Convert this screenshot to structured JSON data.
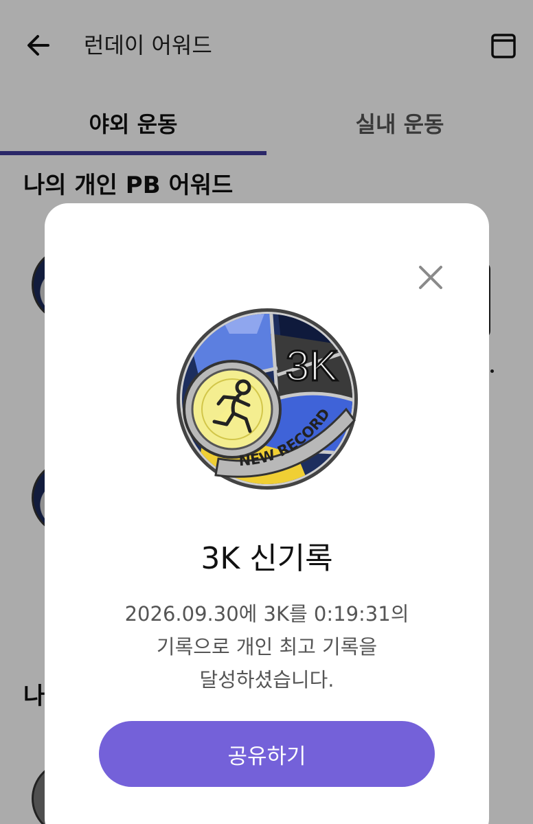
{
  "app_bar": {
    "title": "런데이 어워드",
    "back_icon": "back-arrow-icon",
    "archive_icon": "box-icon"
  },
  "tabs": [
    {
      "label": "야외 운동",
      "selected": true
    },
    {
      "label": "실내 운동",
      "selected": false
    }
  ],
  "colors": {
    "accent": "#7461d9",
    "tab_indicator": "#3f3b9c",
    "scrim": "rgba(0,0,0,0.33)"
  },
  "sections": {
    "pb_title": "나의 개인 PB 어워드",
    "second_title_fragment": "나"
  },
  "dialog": {
    "badge": {
      "icon": "new-record-3k-medal-icon",
      "distance_text": "3K",
      "banner_text": "NEW RECORD"
    },
    "title": "3K 신기록",
    "description": {
      "line1": "2026.09.30에 3K를 0:19:31의",
      "line2": "기록으로 개인 최고 기록을",
      "line3": "달성하셨습니다."
    },
    "share_label": "공유하기",
    "close_icon": "close-icon"
  }
}
